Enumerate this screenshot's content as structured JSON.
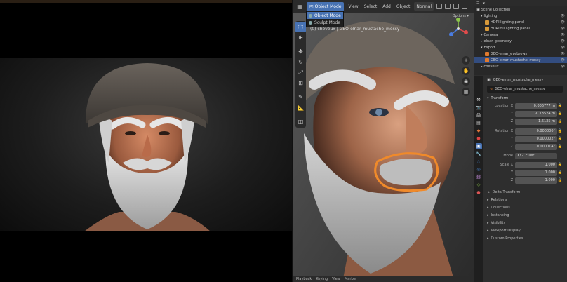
{
  "viewport": {
    "mode_label": "Object Mode",
    "menus": [
      "View",
      "Select",
      "Add",
      "Object"
    ],
    "shading_label": "Normal",
    "options_label": "Options",
    "dropdown": [
      {
        "label": "Object Mode",
        "active": true
      },
      {
        "label": "Sculpt Mode",
        "active": false
      }
    ],
    "info_text": "(0) cheveux | GEO-elnar_mustache_messy",
    "footer": [
      "Playback",
      "Keying",
      "View",
      "Marker"
    ]
  },
  "outliner": {
    "rows": [
      {
        "indent": 0,
        "label": "Scene Collection",
        "color": "#9a9a9a",
        "state": ""
      },
      {
        "indent": 1,
        "label": "lighting",
        "color": "#c8c8c8",
        "state": ""
      },
      {
        "indent": 2,
        "label": "HDRI lighting panel",
        "color": "#d99a3a",
        "state": ""
      },
      {
        "indent": 2,
        "label": "HDRI fill lighting panel",
        "color": "#d99a3a",
        "state": ""
      },
      {
        "indent": 1,
        "label": "Camera",
        "color": "#c8c8c8",
        "state": ""
      },
      {
        "indent": 1,
        "label": "elnar_geometry",
        "color": "#c8c8c8",
        "state": ""
      },
      {
        "indent": 1,
        "label": "Export",
        "color": "#c8c8c8",
        "state": ""
      },
      {
        "indent": 2,
        "label": "GEO-elnar_eyebrows",
        "color": "#e07a2e",
        "state": ""
      },
      {
        "indent": 2,
        "label": "GEO-elnar_mustache_messy",
        "color": "#e07a2e",
        "state": "sel"
      },
      {
        "indent": 1,
        "label": "cheveux",
        "color": "#c8c8c8",
        "state": ""
      }
    ]
  },
  "properties": {
    "object_name": "GEO-elnar_mustache_messy",
    "object_field": "GEO-elnar_mustache_messy",
    "transform_label": "Transform",
    "location": {
      "label": "Location X",
      "x": "0.006777 m",
      "y": "-0.13524 m",
      "z": "1.6135 m"
    },
    "rotation": {
      "label": "Rotation X",
      "x": "0.000000°",
      "y": "0.000002°",
      "z": "0.000014°"
    },
    "mode": {
      "label": "Mode",
      "value": "XYZ Euler"
    },
    "scale": {
      "label": "Scale X",
      "x": "1.000",
      "y": "1.000",
      "z": "1.000"
    },
    "axis_y": "Y",
    "axis_z": "Z",
    "collapsed_sections": [
      "Delta Transform",
      "Relations",
      "Collections",
      "Instancing",
      "Visibility",
      "Viewport Display",
      "Custom Properties"
    ]
  },
  "colors": {
    "accent": "#4772b3",
    "mustache_orange": "#f08a2a"
  }
}
